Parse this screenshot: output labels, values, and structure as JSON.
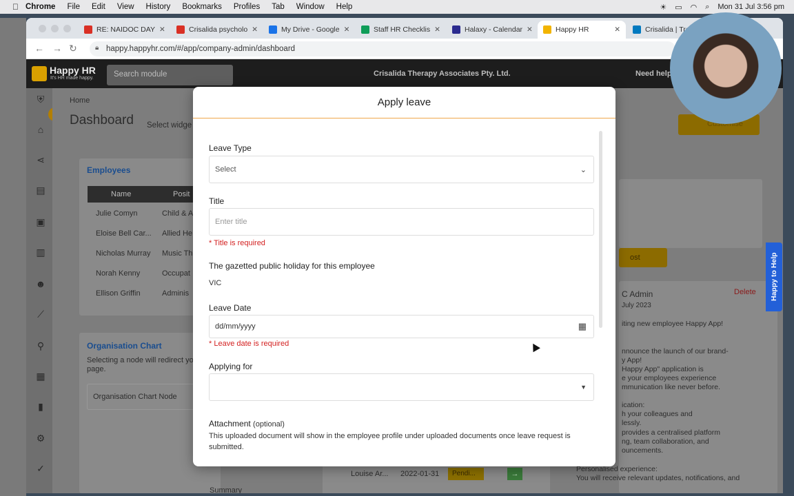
{
  "menubar": {
    "app": "Chrome",
    "items": [
      "File",
      "Edit",
      "View",
      "History",
      "Bookmarks",
      "Profiles",
      "Tab",
      "Window",
      "Help"
    ],
    "datetime": "Mon 31 Jul  3:56 pm"
  },
  "browser": {
    "tabs": [
      {
        "label": "RE: NAIDOC DAY",
        "favicon_color": "#d93025"
      },
      {
        "label": "Crisalida psycholo",
        "favicon_color": "#d93025"
      },
      {
        "label": "My Drive - Google",
        "favicon_color": "#1a73e8"
      },
      {
        "label": "Staff HR Checklis",
        "favicon_color": "#0f9d58"
      },
      {
        "label": "Halaxy - Calendar",
        "favicon_color": "#2b2b8f"
      },
      {
        "label": "Happy HR",
        "favicon_color": "#f2b400"
      },
      {
        "label": "Crisalida | Trello",
        "favicon_color": "#0079bf"
      }
    ],
    "url": "happy.happyhr.com/#/app/company-admin/dashboard"
  },
  "app": {
    "logo_title": "Happy HR",
    "logo_tagline": "It's HR made happy.",
    "search_placeholder": "Search module",
    "company_name": "Crisalida Therapy Associates Pty. Ltd.",
    "need_help": "Need help",
    "breadcrumb": "Home",
    "page_title": "Dashboard",
    "widget_select": "Select widge",
    "customise": "Customise",
    "employees_card": {
      "title": "Employees",
      "headers": [
        "Name",
        "Posit"
      ],
      "rows": [
        [
          "Julie Comyn",
          "Child & A"
        ],
        [
          "Eloise Bell Car...",
          "Allied He"
        ],
        [
          "Nicholas Murray",
          "Music Th"
        ],
        [
          "Norah Kenny",
          "Occupat"
        ],
        [
          "Ellison Griffin",
          "Adminis"
        ]
      ]
    },
    "org_chart_card": {
      "title": "Organisation Chart",
      "desc": "Selecting a node will redirect yo page.",
      "node_placeholder": "Organisation Chart Node"
    },
    "leave_row": {
      "name": "Louise Ar...",
      "date": "2022-01-31",
      "status": "Pendi..."
    },
    "news_card": {
      "admin": "C Admin",
      "date": "July 2023",
      "delete": "Delete",
      "post": "ost",
      "lines": [
        "iting new employee Happy App!",
        "nnounce the launch of our brand-",
        "y App!",
        "Happy App\" application is",
        "e your employees experience",
        "mmunication like never before.",
        "ication:",
        "h your colleagues and",
        "lessly.",
        "provides a centralised platform",
        "ng, team collaboration, and",
        "ouncements.",
        "Personalised experience:",
        "You will receive relevant updates, notifications, and"
      ]
    },
    "summary": "Summary",
    "happy_to_help": "Happy to Help"
  },
  "modal": {
    "title": "Apply leave",
    "leave_type_label": "Leave Type",
    "leave_type_value": "Select",
    "title_label": "Title",
    "title_placeholder": "Enter title",
    "title_error": "* Title is required",
    "holiday_label": "The gazetted public holiday for this employee",
    "holiday_value": "VIC",
    "leave_date_label": "Leave Date",
    "leave_date_placeholder": "dd/mm/yyyy",
    "leave_date_error": "* Leave date is required",
    "applying_for_label": "Applying for",
    "applying_for_value": "",
    "attachment_label": "Attachment",
    "attachment_optional": "(optional)",
    "attachment_desc": "This uploaded document will show in the employee profile under uploaded documents once leave request is submitted."
  },
  "colors": {
    "accent_orange": "#f0a64b",
    "error_red": "#d32020",
    "help_blue": "#2360d8",
    "brand_yellow": "#d9a000"
  }
}
